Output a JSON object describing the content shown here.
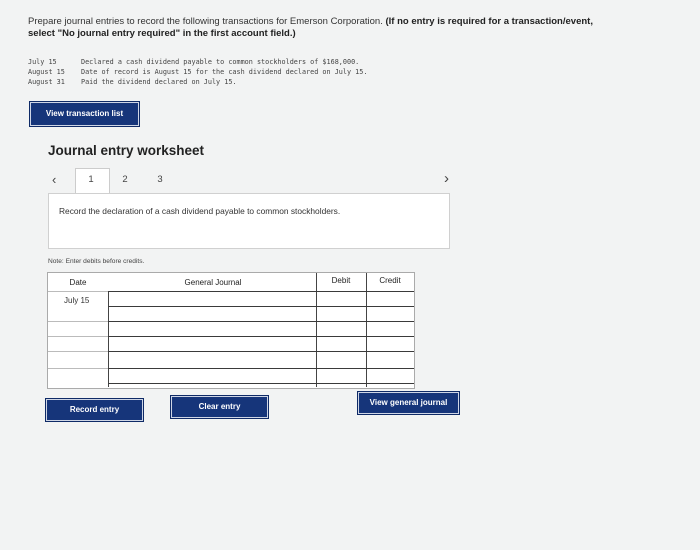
{
  "instructions": {
    "line1": "Prepare journal entries to record the following transactions for Emerson Corporation.",
    "bold1": " (If no entry is required for a transaction/event,",
    "bold2": "select \"No journal entry required\" in the first account field.)"
  },
  "transactions": [
    {
      "date": "July 15",
      "text": "Declared a cash dividend payable to common stockholders of $168,000."
    },
    {
      "date": "August 15",
      "text": "Date of record is August 15 for the cash dividend declared on July 15."
    },
    {
      "date": "August 31",
      "text": "Paid the dividend declared on July 15."
    }
  ],
  "buttons": {
    "view_list": "View transaction list",
    "record": "Record entry",
    "clear": "Clear entry",
    "view_journal": "View general journal"
  },
  "worksheet": {
    "title": "Journal entry worksheet",
    "prev_icon": "‹",
    "next_icon": "›",
    "tabs": [
      "1",
      "2",
      "3"
    ],
    "description": "Record the declaration of a cash dividend payable to common stockholders.",
    "note": "Note: Enter debits before credits."
  },
  "table": {
    "headers": {
      "date": "Date",
      "journal": "General Journal",
      "debit": "Debit",
      "credit": "Credit"
    },
    "first_date": "July 15"
  }
}
